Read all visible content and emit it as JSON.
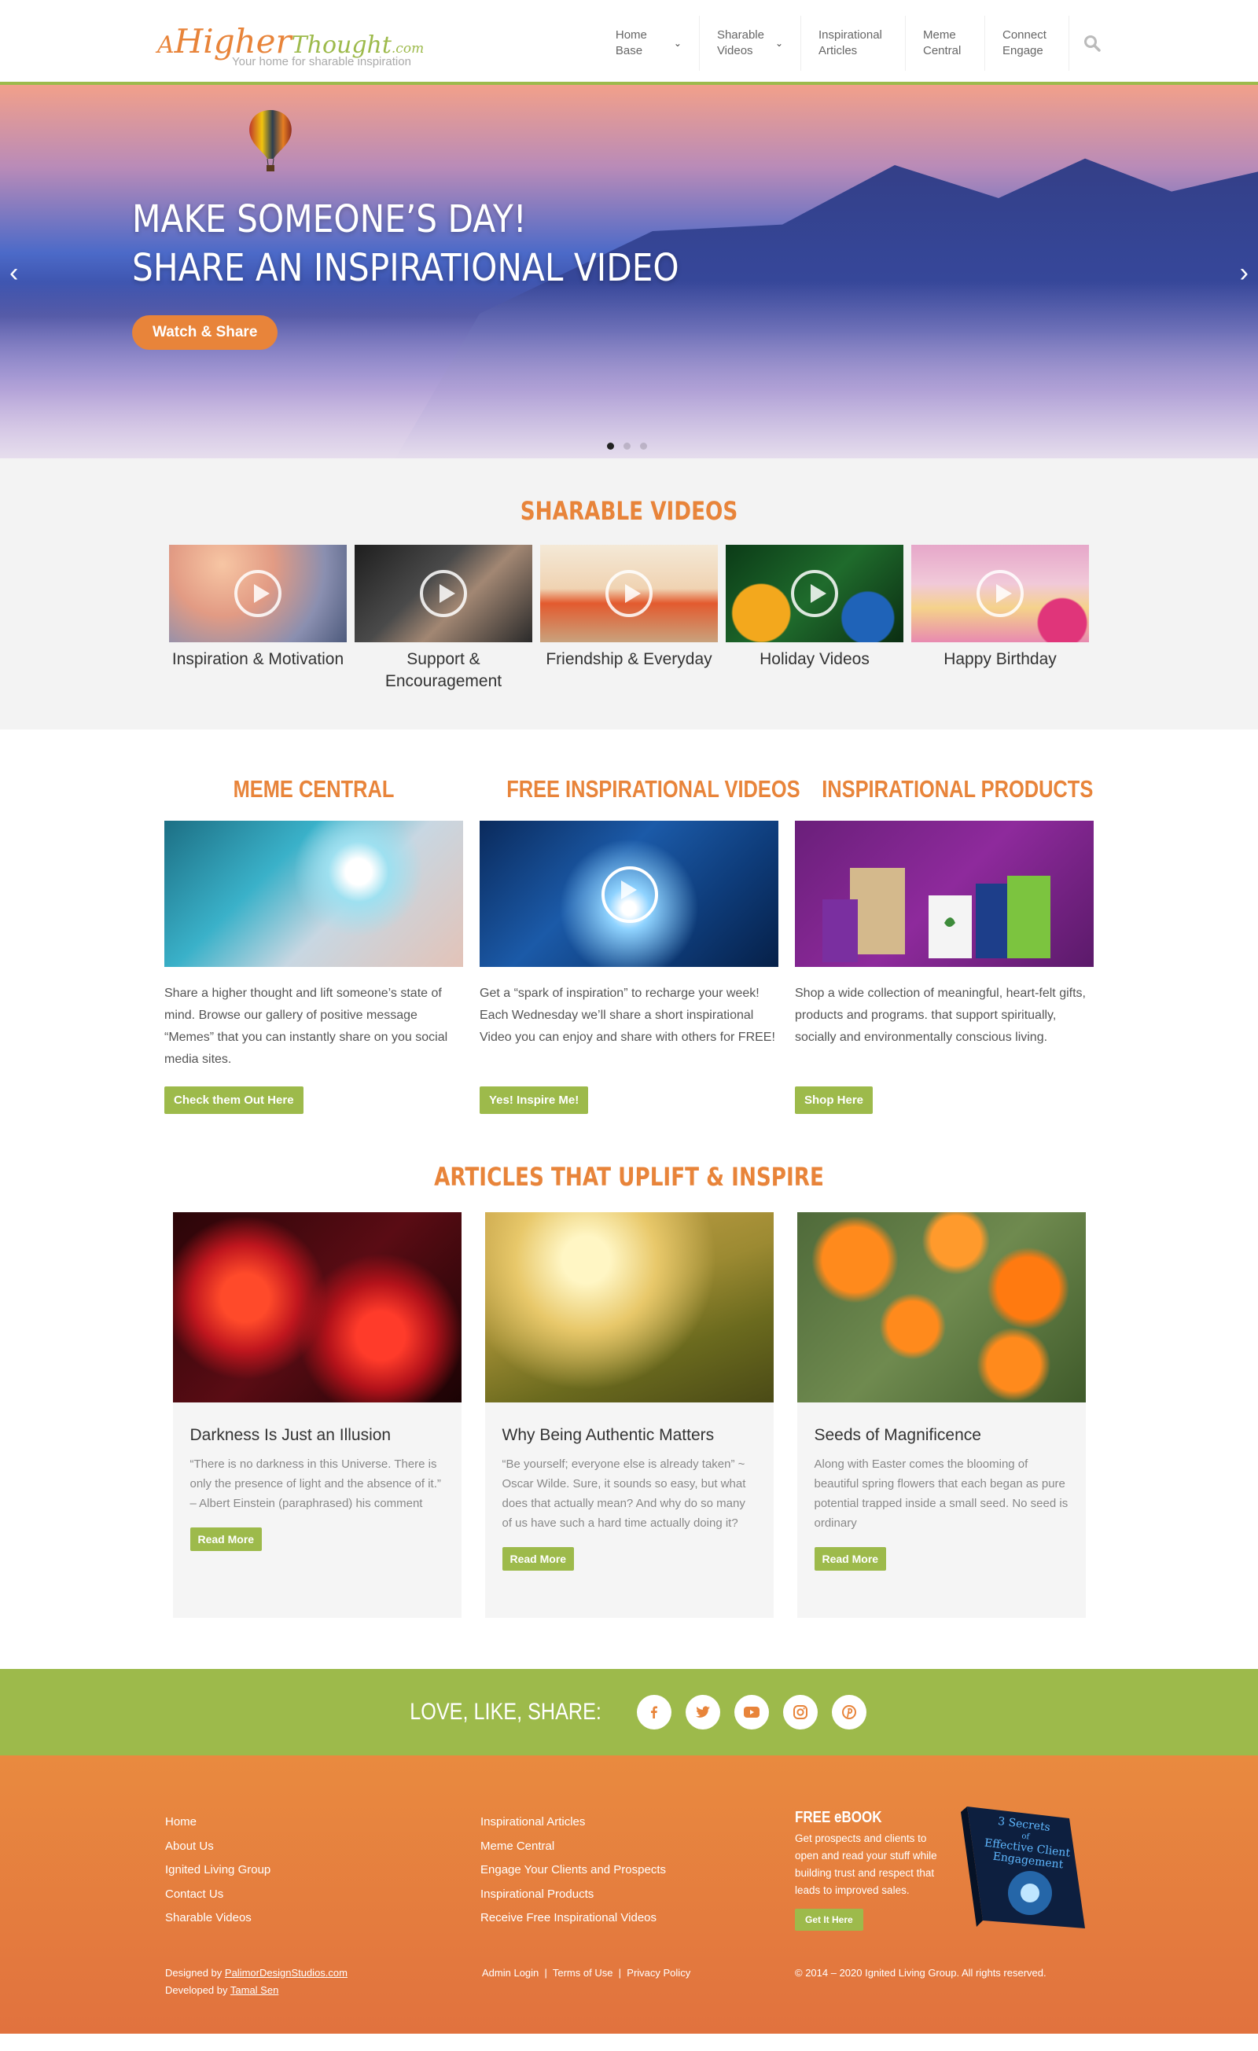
{
  "header": {
    "logo_a": "A",
    "logo_higher": "Higher",
    "logo_thought": "Thought",
    "logo_com": ".com",
    "tagline": "Your home for sharable inspiration",
    "nav": [
      {
        "label": "Home Base",
        "dropdown": true
      },
      {
        "label": "Sharable Videos",
        "dropdown": true
      },
      {
        "label": "Inspirational Articles",
        "dropdown": false
      },
      {
        "label": "Meme Central",
        "dropdown": false
      },
      {
        "label": "Connect Engage",
        "dropdown": false
      }
    ],
    "search_icon": "search-icon"
  },
  "hero": {
    "line1": "MAKE SOMEONE’S DAY!",
    "line2": "SHARE AN INSPIRATIONAL VIDEO",
    "cta": "Watch & Share",
    "slide_count": 3,
    "active_slide": 1
  },
  "videos": {
    "title": "SHARABLE VIDEOS",
    "items": [
      {
        "label": "Inspiration & Motivation",
        "colors": [
          "#e9a98b",
          "#6a7fa8"
        ]
      },
      {
        "label": "Support & Encouragement",
        "colors": [
          "#2b2b2b",
          "#7d6a5a"
        ]
      },
      {
        "label": "Friendship & Everyday",
        "colors": [
          "#f2e1c9",
          "#e24d28"
        ]
      },
      {
        "label": "Holiday Videos",
        "colors": [
          "#0d4d1e",
          "#d38a1c"
        ]
      },
      {
        "label": "Happy Birthday",
        "colors": [
          "#e8a0c8",
          "#f5d08a"
        ]
      }
    ]
  },
  "features": [
    {
      "title": "MEME CENTRAL",
      "text": "Share a higher thought and lift someone’s state of mind. Browse our gallery of positive message “Memes” that you can instantly share on you social media sites.",
      "button": "Check them Out Here"
    },
    {
      "title": "FREE INSPIRATIONAL VIDEOS",
      "text": "Get a “spark of inspiration” to recharge your week! Each Wednesday we’ll share a short inspirational Video you can enjoy and share with others for FREE!",
      "button": "Yes! Inspire Me!"
    },
    {
      "title": "INSPIRATIONAL PRODUCTS",
      "text": "Shop a wide collection of meaningful, heart-felt gifts, products and programs. that support spiritually, socially and environmentally conscious living.",
      "button": "Shop Here"
    }
  ],
  "articles": {
    "title": "ARTICLES THAT UPLIFT & INSPIRE",
    "items": [
      {
        "title": "Darkness Is Just an Illusion",
        "excerpt": "“There is no darkness in this Universe. There is only the presence of light and the absence of it.” – Albert Einstein (paraphrased) his comment",
        "button": "Read More"
      },
      {
        "title": "Why Being Authentic Matters",
        "excerpt": "“Be yourself; everyone else is already taken” ~ Oscar Wilde. Sure, it sounds so easy, but what does that actually mean? And why do so many of us have such a hard time actually doing it?",
        "button": "Read More"
      },
      {
        "title": "Seeds of Magnificence",
        "excerpt": "Along with Easter comes the blooming of beautiful spring flowers that each began as pure potential trapped inside a small seed. No seed is ordinary",
        "button": "Read More"
      }
    ]
  },
  "social": {
    "title": "LOVE, LIKE, SHARE:",
    "icons": [
      "facebook-icon",
      "twitter-icon",
      "youtube-icon",
      "instagram-icon",
      "pinterest-icon"
    ]
  },
  "footer": {
    "col1": [
      "Home",
      "About Us",
      "Ignited Living Group",
      "Contact Us",
      "Sharable Videos"
    ],
    "col2": [
      "Inspirational Articles",
      "Meme Central",
      "Engage Your Clients and Prospects",
      "Inspirational Products",
      "Receive Free Inspirational Videos"
    ],
    "ebook_title": "FREE eBOOK",
    "ebook_text": "Get prospects and clients to open and read your stuff while building trust and respect that leads to improved sales.",
    "ebook_button": "Get It Here",
    "book_line1": "3 Secrets",
    "book_line2": "of",
    "book_line3": "Effective Client",
    "book_line4": "Engagement",
    "designed_by_label": "Designed by",
    "designed_by": "PalimorDesignStudios.com",
    "developed_by_label": "Developed by",
    "developed_by": "Tamal Sen",
    "legal_links": [
      "Admin Login",
      "Terms of Use",
      "Privacy Policy"
    ],
    "copyright": "© 2014 – 2020 Ignited Living Group. All rights reserved."
  }
}
